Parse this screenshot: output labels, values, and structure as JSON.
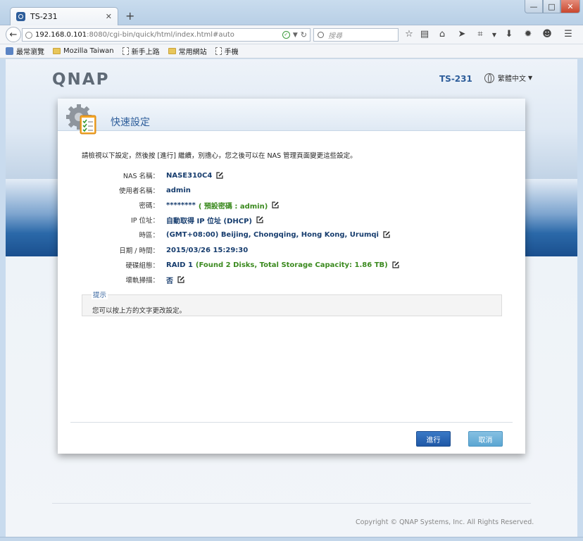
{
  "browser": {
    "tab_title": "TS-231",
    "tab_close": "✕",
    "new_tab": "+",
    "window_controls": {
      "minimize": "—",
      "maximize": "□",
      "close": "✕"
    },
    "url_host": "192.168.0.101",
    "url_path": ":8080/cgi-bin/quick/html/index.html#auto",
    "search_placeholder": "搜尋",
    "toolbar_icons": [
      "star-icon",
      "clipboard-icon",
      "home-icon",
      "send-icon",
      "crop-icon",
      "download-icon",
      "settings-icon",
      "smiley-icon",
      "menu-icon"
    ]
  },
  "bookmarks": [
    {
      "label": "最常瀏覽",
      "icon": "star-folder-icon"
    },
    {
      "label": "Mozilla Taiwan",
      "icon": "folder-icon"
    },
    {
      "label": "新手上路",
      "icon": "page-icon"
    },
    {
      "label": "常用網站",
      "icon": "folder-icon"
    },
    {
      "label": "手機",
      "icon": "page-icon"
    }
  ],
  "header": {
    "logo": "QNAP",
    "model": "TS-231",
    "language": "繁體中文"
  },
  "wizard": {
    "title": "快速設定",
    "intro": "請檢視以下設定，然後按 [進行] 繼續，別擔心，您之後可以在 NAS 管理頁面變更這些設定。",
    "rows": [
      {
        "label": "NAS 名稱：",
        "value": "NASE310C4",
        "extra": "",
        "editable": true
      },
      {
        "label": "使用者名稱：",
        "value": "admin",
        "extra": "",
        "editable": false
      },
      {
        "label": "密碼：",
        "value": "********",
        "extra": "( 預設密碼 : admin)",
        "editable": true
      },
      {
        "label": "IP 位址：",
        "value": "自動取得 IP 位址 (DHCP)",
        "extra": "",
        "editable": true
      },
      {
        "label": "時區：",
        "value": "(GMT+08:00) Beijing, Chongqing, Hong Kong, Urumqi",
        "extra": "",
        "editable": true
      },
      {
        "label": "日期 / 時間：",
        "value": "2015/03/26 15:29:30",
        "extra": "",
        "editable": false
      },
      {
        "label": "硬碟組態：",
        "value": "RAID 1",
        "extra": "(Found 2 Disks, Total Storage Capacity: 1.86 TB)",
        "editable": true
      },
      {
        "label": "壞軌掃描：",
        "value": "否",
        "extra": "",
        "editable": true
      }
    ],
    "hint_title": "提示",
    "hint_text": "您可以按上方的文字更改設定。",
    "next_label": "進行",
    "cancel_label": "取消"
  },
  "footer": {
    "copyright": "Copyright © QNAP Systems, Inc. All Rights Reserved."
  },
  "colors": {
    "accent": "#2d5d9a",
    "value_text": "#173d6e",
    "extra_text": "#3b8a1f",
    "next_button": "#2a65b3",
    "cancel_button": "#6cb2da"
  }
}
